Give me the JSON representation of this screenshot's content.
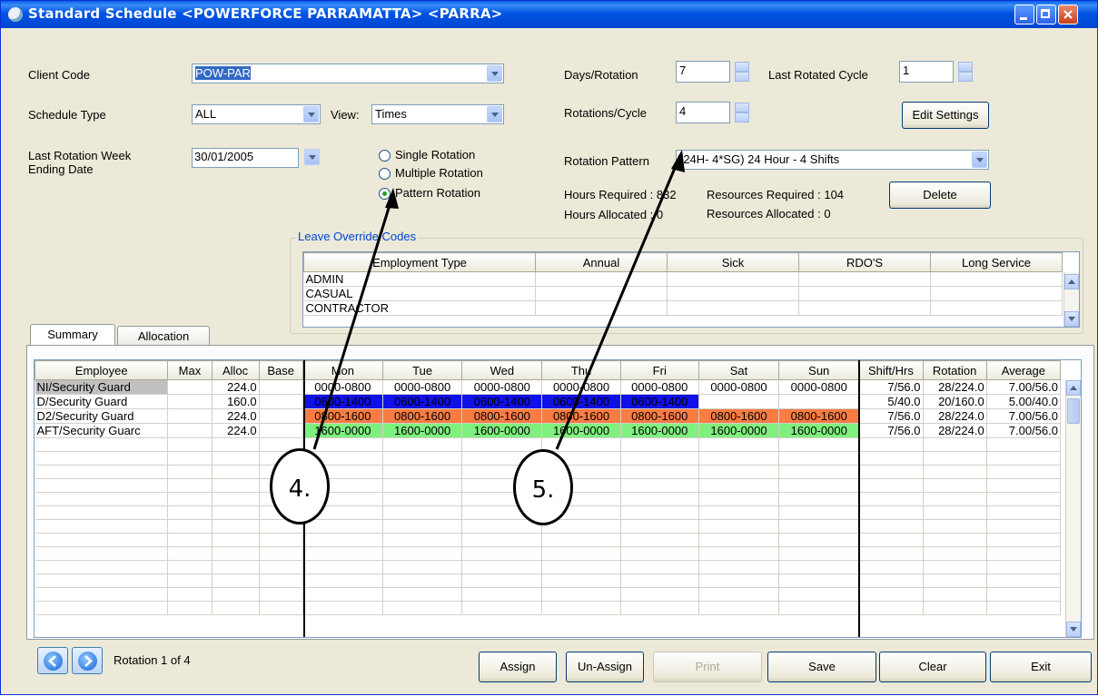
{
  "window": {
    "title": "Standard Schedule <POWERFORCE PARRAMATTA> <PARRA>"
  },
  "form": {
    "client_code_label": "Client Code",
    "client_code_value": "POW-PAR",
    "schedule_type_label": "Schedule Type",
    "schedule_type_value": "ALL",
    "view_label": "View:",
    "view_value": "Times",
    "last_rotation_label_1": "Last Rotation Week",
    "last_rotation_label_2": "Ending Date",
    "last_rotation_value": "30/01/2005",
    "radios": [
      {
        "label": "Single Rotation",
        "checked": false
      },
      {
        "label": "Multiple Rotation",
        "checked": false
      },
      {
        "label": "Pattern Rotation",
        "checked": true
      }
    ],
    "days_rotation_label": "Days/Rotation",
    "days_rotation_value": "7",
    "last_rotated_cycle_label": "Last Rotated Cycle",
    "last_rotated_cycle_value": "1",
    "rotations_cycle_label": "Rotations/Cycle",
    "rotations_cycle_value": "4",
    "edit_settings_label": "Edit Settings",
    "rotation_pattern_label": "Rotation Pattern",
    "rotation_pattern_value": "(24H- 4*SG) 24 Hour - 4 Shifts",
    "hours_required": "Hours Required : 832",
    "resources_required": "Resources Required : 104",
    "hours_allocated": "Hours Allocated : 0",
    "resources_allocated": "Resources  Allocated : 0",
    "delete_label": "Delete"
  },
  "leave": {
    "title": "Leave Override Codes",
    "columns": [
      "Employment Type",
      "Annual",
      "Sick",
      "RDO'S",
      "Long Service"
    ],
    "rows": [
      "ADMIN",
      "CASUAL",
      "CONTRACTOR"
    ]
  },
  "tabs": [
    "Summary",
    "Allocation"
  ],
  "schedule": {
    "columns": [
      "Employee",
      "Max",
      "Alloc",
      "Base",
      "Mon",
      "Tue",
      "Wed",
      "Thu",
      "Fri",
      "Sat",
      "Sun",
      "Shift/Hrs",
      "Rotation",
      "Average"
    ],
    "rows": [
      {
        "employee": "NI/Security Guard",
        "max": "",
        "alloc": "224.0",
        "base": "",
        "days": [
          "0000-0800",
          "0000-0800",
          "0000-0800",
          "0000-0800",
          "0000-0800",
          "0000-0800",
          "0000-0800"
        ],
        "color": "#ffffff",
        "text": "#000000",
        "shift": "7/56.0",
        "rotation": "28/224.0",
        "average": "7.00/56.0"
      },
      {
        "employee": "D/Security Guard",
        "max": "",
        "alloc": "160.0",
        "base": "",
        "days": [
          "0600-1400",
          "0600-1400",
          "0600-1400",
          "0600-1400",
          "0600-1400",
          "",
          ""
        ],
        "color": "#1010e8",
        "text": "#000000",
        "shift": "5/40.0",
        "rotation": "20/160.0",
        "average": "5.00/40.0"
      },
      {
        "employee": "D2/Security Guard",
        "max": "",
        "alloc": "224.0",
        "base": "",
        "days": [
          "0800-1600",
          "0800-1600",
          "0800-1600",
          "0800-1600",
          "0800-1600",
          "0800-1600",
          "0800-1600"
        ],
        "color": "#f97c42",
        "text": "#000000",
        "shift": "7/56.0",
        "rotation": "28/224.0",
        "average": "7.00/56.0"
      },
      {
        "employee": "AFT/Security Guarc",
        "max": "",
        "alloc": "224.0",
        "base": "",
        "days": [
          "1600-0000",
          "1600-0000",
          "1600-0000",
          "1600-0000",
          "1600-0000",
          "1600-0000",
          "1600-0000"
        ],
        "color": "#7ff07f",
        "text": "#000000",
        "shift": "7/56.0",
        "rotation": "28/224.0",
        "average": "7.00/56.0"
      }
    ]
  },
  "footer": {
    "rotation_text": "Rotation 1 of 4",
    "buttons": [
      "Assign",
      "Un-Assign",
      "Print",
      "Save",
      "Clear",
      "Exit"
    ]
  },
  "callouts": [
    "4.",
    "5."
  ]
}
